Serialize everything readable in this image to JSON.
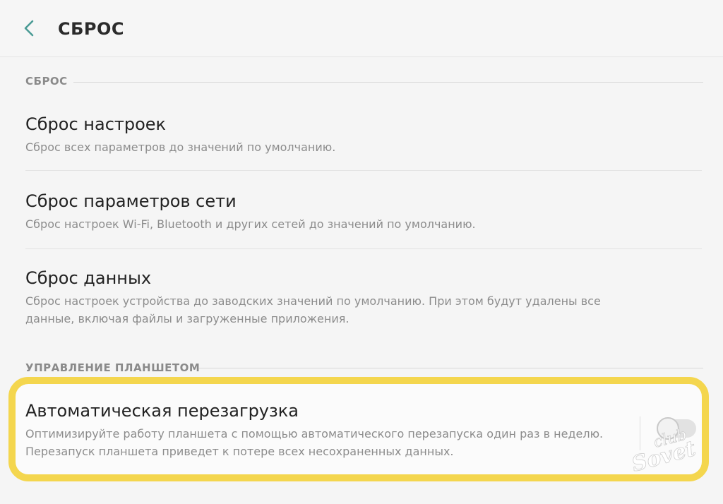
{
  "header": {
    "title": "СБРОС",
    "back_icon": "chevron-left-icon"
  },
  "sections": [
    {
      "header": "СБРОС",
      "items": [
        {
          "title": "Сброс настроек",
          "subtitle": "Сброс всех параметров до значений по умолчанию."
        },
        {
          "title": "Сброс параметров сети",
          "subtitle": "Сброс настроек Wi-Fi, Bluetooth и других сетей до значений по умолчанию."
        },
        {
          "title": "Сброс данных",
          "subtitle": "Сброс настроек устройства до заводских значений по умолчанию. При этом будут удалены все данные, включая файлы и загруженные приложения."
        }
      ]
    },
    {
      "header": "УПРАВЛЕНИЕ ПЛАНШЕТОМ",
      "items": [
        {
          "title": "Автоматическая перезагрузка",
          "subtitle": "Оптимизируйте работу планшета с помощью автоматического перезапуска один раз в неделю. Перезапуск планшета приведет к потере всех несохраненных данных.",
          "toggle_on": false
        }
      ]
    }
  ],
  "watermark": {
    "text_top": "club",
    "text_bottom": "Sovet"
  },
  "colors": {
    "highlight": "#f4d64e",
    "accent": "#4a9b95",
    "background": "#f5f5f5"
  }
}
